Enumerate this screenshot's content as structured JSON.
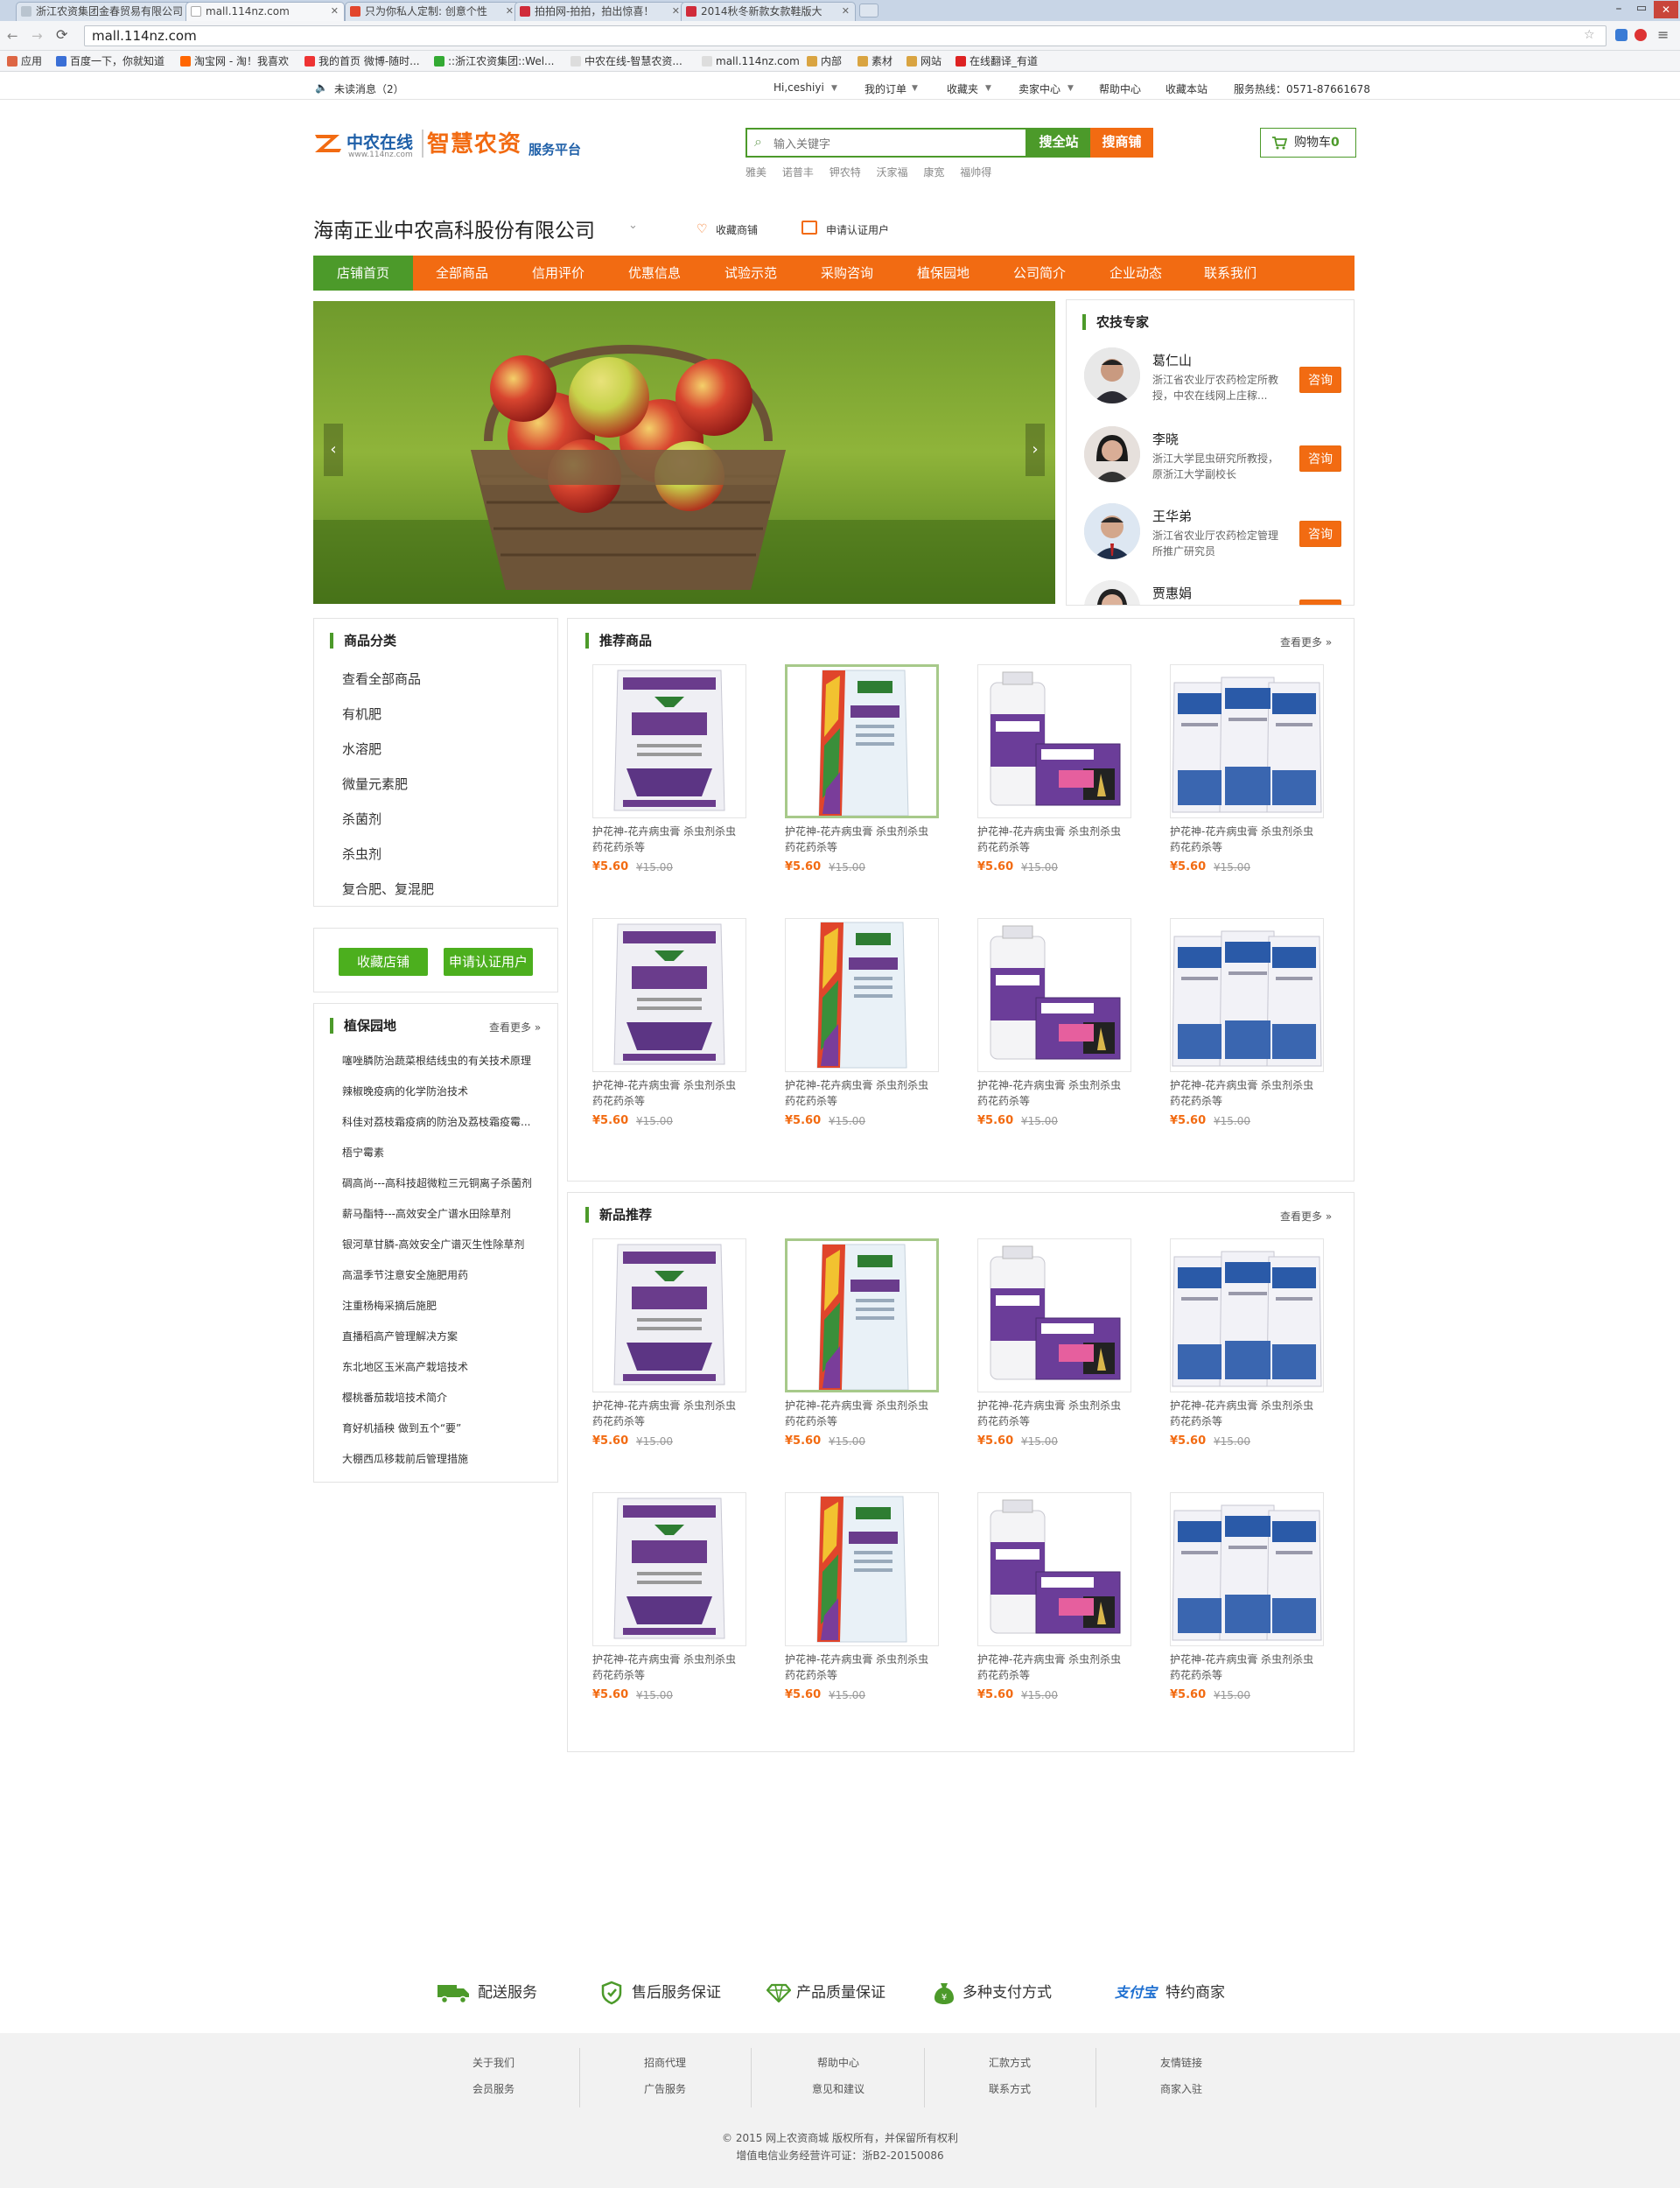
{
  "browser": {
    "tabs": [
      {
        "label": "浙江农资集团金春贸易有限公司"
      },
      {
        "label": "mall.114nz.com"
      },
      {
        "label": "只为你私人定制: 创意个性"
      },
      {
        "label": "拍拍网-拍拍，拍出惊喜！"
      },
      {
        "label": "2014秋冬新款女款鞋版大"
      }
    ],
    "url": "mall.114nz.com",
    "bookmarks": [
      "应用",
      "百度一下，你就知道",
      "淘宝网 - 淘！我喜欢",
      "我的首页 微博-随时...",
      "::浙江农资集团::Wel...",
      "中农在线-智慧农资...",
      "mall.114nz.com",
      "内部",
      "素材",
      "网站",
      "在线翻译_有道"
    ]
  },
  "topbar": {
    "messages": "未读消息（2）",
    "greeting": "Hi,ceshiyi",
    "my_orders": "我的订单",
    "favorites": "收藏夹",
    "seller_center": "卖家中心",
    "help": "帮助中心",
    "bookmark_site": "收藏本站",
    "hotline": "服务热线：0571-87661678"
  },
  "header": {
    "logo_text": "中农在线",
    "logo_url": "www.114nz.com",
    "platform_big": "智慧农资",
    "platform_small": "服务平台",
    "search_placeholder": "输入关键字",
    "search_all": "搜全站",
    "search_shop": "搜商铺",
    "hot_keywords": [
      "雅美",
      "诺普丰",
      "钾农特",
      "沃家福",
      "康宽",
      "福帅得"
    ],
    "cart": "购物车",
    "cart_count": "0"
  },
  "store": {
    "name": "海南正业中农高科股份有限公司",
    "favorite": "收藏商铺",
    "apply": "申请认证用户",
    "nav": [
      "店铺首页",
      "全部商品",
      "信用评价",
      "优惠信息",
      "试验示范",
      "采购咨询",
      "植保园地",
      "公司简介",
      "企业动态",
      "联系我们"
    ]
  },
  "experts": {
    "title": "农技专家",
    "consult_label": "咨询",
    "items": [
      {
        "name": "葛仁山",
        "desc": "浙江省农业厅农药检定所教授，中农在线网上庄稼..."
      },
      {
        "name": "李晓",
        "desc": "浙江大学昆虫研究所教授，原浙江大学副校长"
      },
      {
        "name": "王华弟",
        "desc": "浙江省农业厅农药检定管理所推广研究员"
      },
      {
        "name": "贾惠娟",
        "desc": ""
      }
    ]
  },
  "categories": {
    "title": "商品分类",
    "items": [
      "查看全部商品",
      "有机肥",
      "水溶肥",
      "微量元素肥",
      "杀菌剂",
      "杀虫剂",
      "复合肥、复混肥"
    ]
  },
  "actions": {
    "favorite_store": "收藏店铺",
    "apply_user": "申请认证用户"
  },
  "garden": {
    "title": "植保园地",
    "more": "查看更多",
    "articles": [
      "噻唑膦防治蔬菜根结线虫的有关技术原理",
      "辣椒晚疫病的化学防治技术",
      "科佳对荔枝霜疫病的防治及荔枝霜疫霉...",
      "梧宁霉素",
      "碉高尚---高科技超微粒三元铜离子杀菌剂",
      "薪马酯特---高效安全广谱水田除草剂",
      "银河草甘膦-高效安全广谱灭生性除草剂",
      "高温季节注意安全施肥用药",
      "注重杨梅采摘后施肥",
      "直播稻高产管理解决方案",
      "东北地区玉米高产栽培技术",
      "樱桃番茄栽培技术简介",
      "育好机插秧 做到五个“要”",
      "大棚西瓜移栽前后管理措施"
    ]
  },
  "recommended": {
    "title": "推荐商品",
    "more": "查看更多",
    "products": [
      {
        "name": "护花神-花卉病虫膏 杀虫剂杀虫药花药杀等",
        "price": "¥5.60",
        "old_price": "¥15.00",
        "img": "bag-purple"
      },
      {
        "name": "护花神-花卉病虫膏 杀虫剂杀虫药花药杀等",
        "price": "¥5.60",
        "old_price": "¥15.00",
        "img": "bag-colorful"
      },
      {
        "name": "护花神-花卉病虫膏 杀虫剂杀虫药花药杀等",
        "price": "¥5.60",
        "old_price": "¥15.00",
        "img": "bottle-box"
      },
      {
        "name": "护花神-花卉病虫膏 杀虫剂杀虫药花药杀等",
        "price": "¥5.60",
        "old_price": "¥15.00",
        "img": "bags-blue"
      },
      {
        "name": "护花神-花卉病虫膏 杀虫剂杀虫药花药杀等",
        "price": "¥5.60",
        "old_price": "¥15.00",
        "img": "bag-purple"
      },
      {
        "name": "护花神-花卉病虫膏 杀虫剂杀虫药花药杀等",
        "price": "¥5.60",
        "old_price": "¥15.00",
        "img": "bag-colorful"
      },
      {
        "name": "护花神-花卉病虫膏 杀虫剂杀虫药花药杀等",
        "price": "¥5.60",
        "old_price": "¥15.00",
        "img": "bottle-box"
      },
      {
        "name": "护花神-花卉病虫膏 杀虫剂杀虫药花药杀等",
        "price": "¥5.60",
        "old_price": "¥15.00",
        "img": "bags-blue"
      }
    ]
  },
  "new_products": {
    "title": "新品推荐",
    "more": "查看更多",
    "products": [
      {
        "name": "护花神-花卉病虫膏 杀虫剂杀虫药花药杀等",
        "price": "¥5.60",
        "old_price": "¥15.00",
        "img": "bag-purple"
      },
      {
        "name": "护花神-花卉病虫膏 杀虫剂杀虫药花药杀等",
        "price": "¥5.60",
        "old_price": "¥15.00",
        "img": "bag-colorful"
      },
      {
        "name": "护花神-花卉病虫膏 杀虫剂杀虫药花药杀等",
        "price": "¥5.60",
        "old_price": "¥15.00",
        "img": "bottle-box"
      },
      {
        "name": "护花神-花卉病虫膏 杀虫剂杀虫药花药杀等",
        "price": "¥5.60",
        "old_price": "¥15.00",
        "img": "bags-blue"
      },
      {
        "name": "护花神-花卉病虫膏 杀虫剂杀虫药花药杀等",
        "price": "¥5.60",
        "old_price": "¥15.00",
        "img": "bag-purple"
      },
      {
        "name": "护花神-花卉病虫膏 杀虫剂杀虫药花药杀等",
        "price": "¥5.60",
        "old_price": "¥15.00",
        "img": "bag-colorful"
      },
      {
        "name": "护花神-花卉病虫膏 杀虫剂杀虫药花药杀等",
        "price": "¥5.60",
        "old_price": "¥15.00",
        "img": "bottle-box"
      },
      {
        "name": "护花神-花卉病虫膏 杀虫剂杀虫药花药杀等",
        "price": "¥5.60",
        "old_price": "¥15.00",
        "img": "bags-blue"
      }
    ]
  },
  "services": [
    "配送服务",
    "售后服务保证",
    "产品质量保证",
    "多种支付方式",
    "特约商家"
  ],
  "alipay_logo": "支付宝",
  "footer": {
    "columns": [
      [
        "关于我们",
        "会员服务"
      ],
      [
        "招商代理",
        "广告服务"
      ],
      [
        "帮助中心",
        "意见和建议"
      ],
      [
        "汇款方式",
        "联系方式"
      ],
      [
        "友情链接",
        "商家入驻"
      ]
    ],
    "copyright": "© 2015 网上农资商城 版权所有，并保留所有权利",
    "license": "增值电信业务经营许可证：浙B2-20150086"
  },
  "colors": {
    "brand_green": "#4c9a2a",
    "brand_orange": "#f26b12",
    "logo_blue": "#1e5fa8"
  }
}
